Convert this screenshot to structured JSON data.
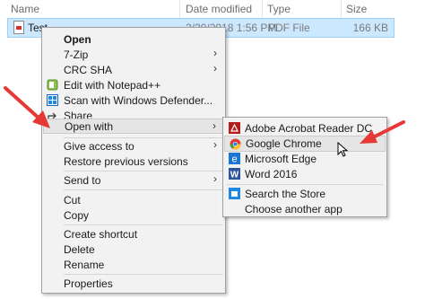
{
  "columns": {
    "name": "Name",
    "date": "Date modified",
    "type": "Type",
    "size": "Size"
  },
  "file": {
    "name": "Test",
    "date": "2/20/2018 1:56 PM",
    "type": "PDF File",
    "size": "166 KB"
  },
  "menu": {
    "open": "Open",
    "zip": "7-Zip",
    "crc": "CRC SHA",
    "notepad": "Edit with Notepad++",
    "defender": "Scan with Windows Defender...",
    "share": "Share",
    "open_with": "Open with",
    "give_access": "Give access to",
    "restore": "Restore previous versions",
    "send_to": "Send to",
    "cut": "Cut",
    "copy": "Copy",
    "create_shortcut": "Create shortcut",
    "delete": "Delete",
    "rename": "Rename",
    "properties": "Properties"
  },
  "submenu": {
    "acrobat": "Adobe Acrobat Reader DC",
    "chrome": "Google Chrome",
    "edge": "Microsoft Edge",
    "word": "Word 2016",
    "store": "Search the Store",
    "choose": "Choose another app"
  },
  "colors": {
    "arrow": "#e53935",
    "highlight": "#e5e5e5",
    "selection": "#cce8ff"
  },
  "icons": [
    "pdf-file-icon",
    "notepad-plus-icon",
    "windows-defender-icon",
    "share-icon",
    "acrobat-icon",
    "chrome-icon",
    "edge-icon",
    "word-icon",
    "store-icon",
    "mouse-cursor-icon",
    "red-arrow"
  ]
}
